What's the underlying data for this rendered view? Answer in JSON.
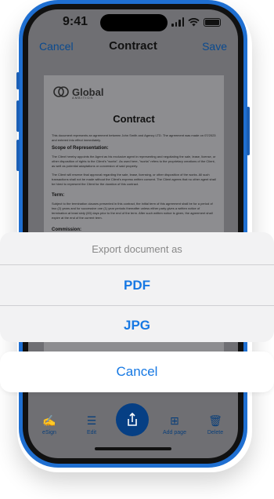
{
  "status_bar": {
    "time": "9:41"
  },
  "nav": {
    "cancel": "Cancel",
    "title": "Contract",
    "save": "Save"
  },
  "document": {
    "logo_text": "Global",
    "logo_subtext": "AMBITION",
    "title": "Contract",
    "intro": "This document represents an agreement between John Smith and Agency LTD. The agreement was made on 07/2023 and entered into effect immediately.",
    "section1_heading": "Scope of Representation:",
    "section1_text": "The Client hereby appoints the Agent as his exclusive agent in representing and negotiating the sale, lease, license, or other disposition of rights to the Client's \"works\". As used here, \"works\" refers to the proprietary creations of the Client, as well as potential adaptations or conversion of said property.",
    "section1_text2": "The Client will reserve final approval regarding the sale, lease, licensing, or other disposition of the works. All such transactions shall not be made without the Client's express written consent. The Client agrees that no other agent shall be hired to represent the Client for the duration of this contract.",
    "section2_heading": "Term:",
    "section2_text": "Subject to the termination clauses presented in this contract, the initial term of this agreement shall be for a period of two (2) years and for successive one (1) year periods thereafter unless either party gives a written notice of termination at least sixty (60) days prior to the end of the term. After such written notice is given, the agreement shall expire at the end of the current term.",
    "section3_heading": "Commission:"
  },
  "tabbar": {
    "esign": "eSign",
    "edit": "Edit",
    "add_page": "Add page",
    "delete": "Delete"
  },
  "action_sheet": {
    "title": "Export document as",
    "options": [
      "PDF",
      "JPG"
    ],
    "cancel": "Cancel"
  },
  "colors": {
    "accent": "#1678e3",
    "frame": "#1f6fd1",
    "fab": "#063f84"
  }
}
